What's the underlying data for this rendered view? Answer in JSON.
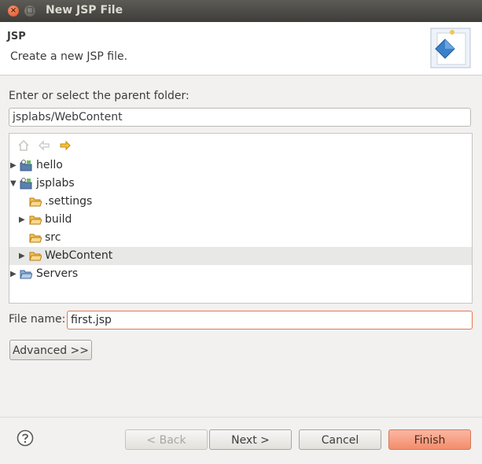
{
  "window": {
    "title": "New JSP File",
    "close_glyph": "×",
    "max_glyph": "□"
  },
  "header": {
    "title": "JSP",
    "description": "Create a new JSP file.",
    "banner_icon": "jsp-wizard-banner-icon"
  },
  "folder": {
    "label": "Enter or select the parent folder:",
    "value": "jsplabs/WebContent"
  },
  "tree_toolbar": [
    "home-icon",
    "back-arrow-icon",
    "forward-arrow-icon"
  ],
  "tree": [
    {
      "label": "hello",
      "expander": "▶",
      "icon": "project-icon"
    },
    {
      "label": "jsplabs",
      "expander": "▼",
      "icon": "project-icon"
    },
    {
      "label": ".settings",
      "expander": "",
      "icon": "folder-icon"
    },
    {
      "label": "build",
      "expander": "▶",
      "icon": "folder-icon"
    },
    {
      "label": "src",
      "expander": "",
      "icon": "folder-icon"
    },
    {
      "label": "WebContent",
      "expander": "▶",
      "icon": "folder-icon",
      "selected": true
    },
    {
      "label": "Servers",
      "expander": "▶",
      "icon": "folder-icon"
    }
  ],
  "file": {
    "label": "File name:",
    "value": "first.jsp"
  },
  "buttons": {
    "advanced": "Advanced >>",
    "back": "< Back",
    "next": "Next >",
    "cancel": "Cancel",
    "finish": "Finish"
  },
  "colors": {
    "accent": "#f28d6c",
    "folder": "#e8a23c",
    "titlebar": "#3e3d39"
  }
}
